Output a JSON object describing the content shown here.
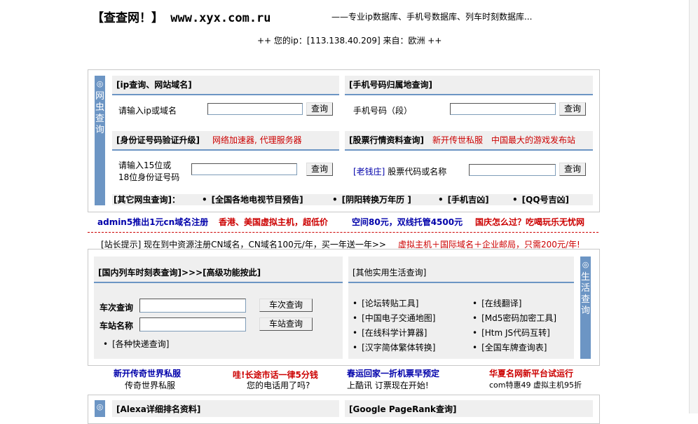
{
  "header": {
    "logo": "【查查网！】 www.xyx.com.ru",
    "tagline": "——专业ip数据库、手机号数据库、列车时刻数据库...",
    "ip_info": "++ 您的ip：[113.138.40.209] 来自：欧洲 ++"
  },
  "spider_section": {
    "side_label": "网虫查询",
    "ip_panel": {
      "title": "[ip查询、网站域名]",
      "label": "请输入ip或域名",
      "button": "查询"
    },
    "phone_panel": {
      "title": "[手机号码归属地查询]",
      "label": "手机号码（段）",
      "button": "查询"
    },
    "id_panel": {
      "title": "[身份证号码验证升级]",
      "ad": "网络加速器, 代理服务器",
      "label_line1": "请输入15位或",
      "label_line2": "18位身份证号码",
      "button": "查询"
    },
    "stock_panel": {
      "title": "[股票行情资料查询]",
      "ad1": "新开传世私服",
      "ad2": "中国最大的游戏发布站",
      "label_prefix": "[老钱庄]",
      "label": " 股票代码或名称",
      "button": "查询"
    },
    "other_bar": {
      "title": "[其它网虫查询]：",
      "links": [
        "[全国各地电视节目预告]",
        "[阴阳转换万年历 ]",
        "[手机吉凶]",
        "[QQ号吉凶]"
      ]
    }
  },
  "promo_row1": [
    "admin5推出1元cn域名注册",
    "香港、美国虚拟主机，超低价",
    "空间80元，双线托管4500元",
    "国庆怎么过？吃喝玩乐无忧网"
  ],
  "notice": {
    "text": "[站长提示] 现在到中资源注册CN域名，CN域名100元/年，买一年送一年>>",
    "ad": "虚拟主机＋国际域名＋企业邮局，只需200元/年!"
  },
  "life_section": {
    "side_label": "生活查询",
    "train_panel": {
      "title": "[国内列车时刻表查询]>>>[高级功能按此]",
      "train_label": "车次查询",
      "train_button": "车次查询",
      "station_label": "车站名称",
      "station_button": "车站查询",
      "express": "[各种快递查询]"
    },
    "life_panel": {
      "title": "[其他实用生活查询]",
      "left_links": [
        "[论坛转贴工具]",
        "[中国电子交通地图]",
        "[在线科学计算器]",
        "[汉字简体繁体转换]"
      ],
      "right_links": [
        "[在线翻译]",
        "[Md5密码加密工具]",
        "[Htm JS代码互转]",
        "[全国车牌查询表]"
      ]
    }
  },
  "promo_row2": [
    {
      "main": "新开传奇世界私服",
      "sub": "传奇世界私服"
    },
    {
      "main": "哇!长途市话一律5分钱",
      "sub": "您的电话用了吗?"
    },
    {
      "main": "春运回家一折机票早预定",
      "sub": "上酷讯 订票现在开始!"
    },
    {
      "main": "华夏名网新平台试运行",
      "sub": "com特惠49 虚拟主机95折"
    }
  ],
  "bottom": {
    "alexa_title": "[Alexa详细排名资料]",
    "pagerank_title": "[Google PageRank查询]"
  },
  "colors": {
    "accent": "#6c95c4",
    "promo_red": "#cc0000",
    "promo_blue": "#0000aa",
    "panel_bg": "#efefef"
  }
}
